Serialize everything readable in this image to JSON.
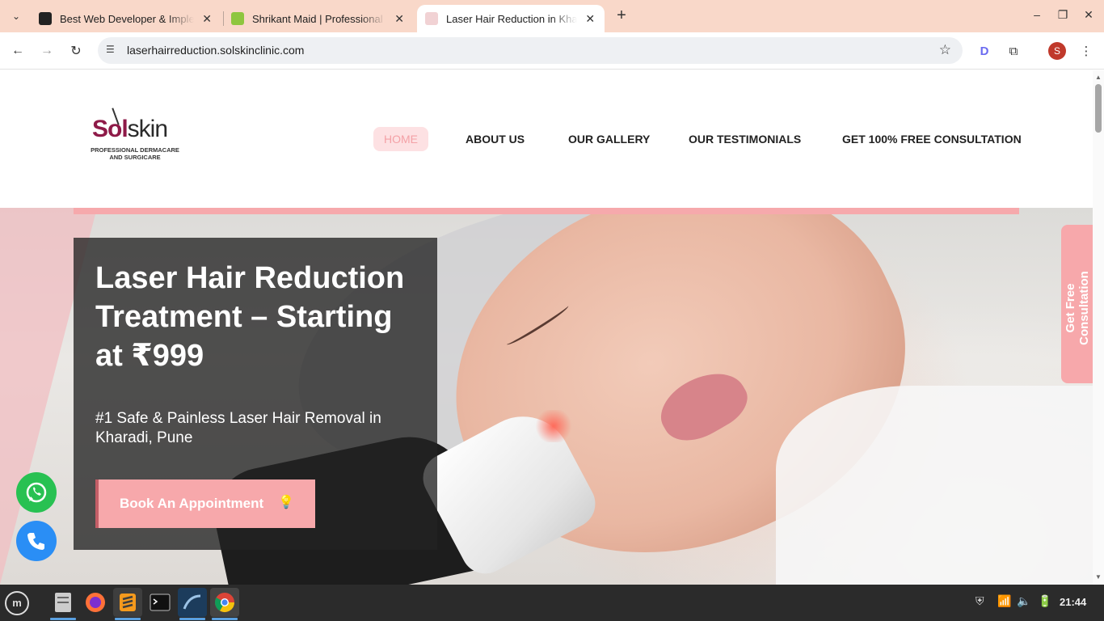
{
  "browser": {
    "tabs": [
      {
        "title": "Best Web Developer & Imple",
        "close": "✕"
      },
      {
        "title": "Shrikant Maid | Professional",
        "close": "✕"
      },
      {
        "title": "Laser Hair Reduction in Khar",
        "close": "✕"
      }
    ],
    "new_tab": "+",
    "url": "laserhairreduction.solskinclinic.com",
    "profile_initial": "S"
  },
  "site": {
    "logo": {
      "brand_a": "Sol",
      "brand_b": "skin",
      "tagline": "PROFESSIONAL DERMACARE AND SURGICARE"
    },
    "nav": [
      "HOME",
      "ABOUT US",
      "OUR GALLERY",
      "OUR TESTIMONIALS",
      "GET 100% FREE CONSULTATION"
    ],
    "hero": {
      "title": "Laser Hair Reduction Treatment – Starting at ₹999",
      "subtitle": "#1 Safe & Painless Laser Hair Removal in Kharadi, Pune",
      "cta": "Book An Appointment"
    },
    "side_cta": "Get Free Consultation"
  },
  "taskbar": {
    "clock": "21:44"
  },
  "colors": {
    "accent_pink": "#f7a8ab",
    "brand_maroon": "#8e1a48",
    "tabstrip": "#f9d8c9"
  }
}
